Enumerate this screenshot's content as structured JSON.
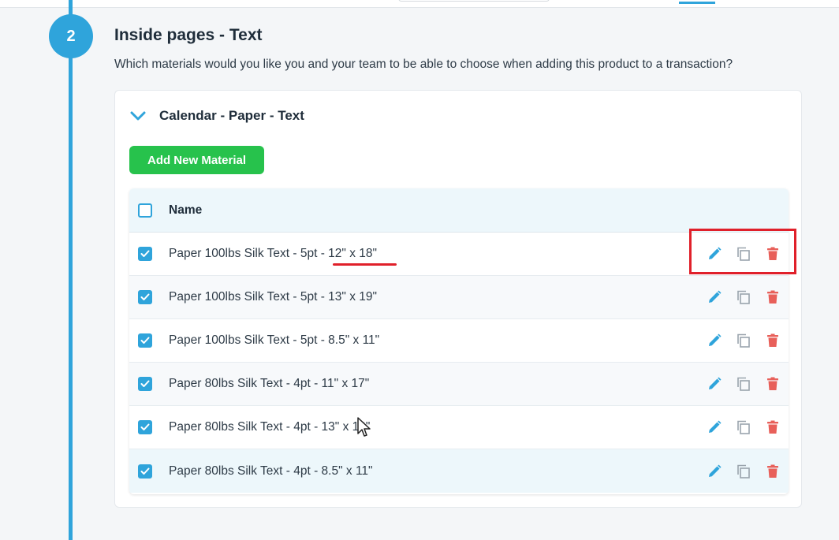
{
  "step": {
    "number": "2",
    "title": "Inside pages - Text",
    "description": "Which materials would you like you and your team to be able to choose when adding this product to a transaction?"
  },
  "group": {
    "title": "Calendar - Paper - Text",
    "expanded": true,
    "add_button_label": "Add New Material"
  },
  "table": {
    "header": {
      "name_label": "Name",
      "select_all_checked": false
    },
    "rows": [
      {
        "name": "Paper 100lbs Silk Text - 5pt - 12\" x 18\"",
        "checked": true
      },
      {
        "name": "Paper 100lbs Silk Text - 5pt - 13\" x 19\"",
        "checked": true
      },
      {
        "name": "Paper 100lbs Silk Text - 5pt - 8.5\" x 11\"",
        "checked": true
      },
      {
        "name": "Paper 80lbs Silk Text - 4pt - 11\" x 17\"",
        "checked": true
      },
      {
        "name": "Paper 80lbs Silk Text - 4pt - 13\" x 19\"",
        "checked": true
      },
      {
        "name": "Paper 80lbs Silk Text - 4pt - 8.5\" x 11\"",
        "checked": true
      }
    ],
    "row_actions": [
      "edit-icon",
      "duplicate-icon",
      "delete-icon"
    ]
  },
  "colors": {
    "accent": "#2fa4db",
    "add_button": "#27c24c",
    "delete": "#e8605a",
    "annotation": "#e0202a"
  }
}
